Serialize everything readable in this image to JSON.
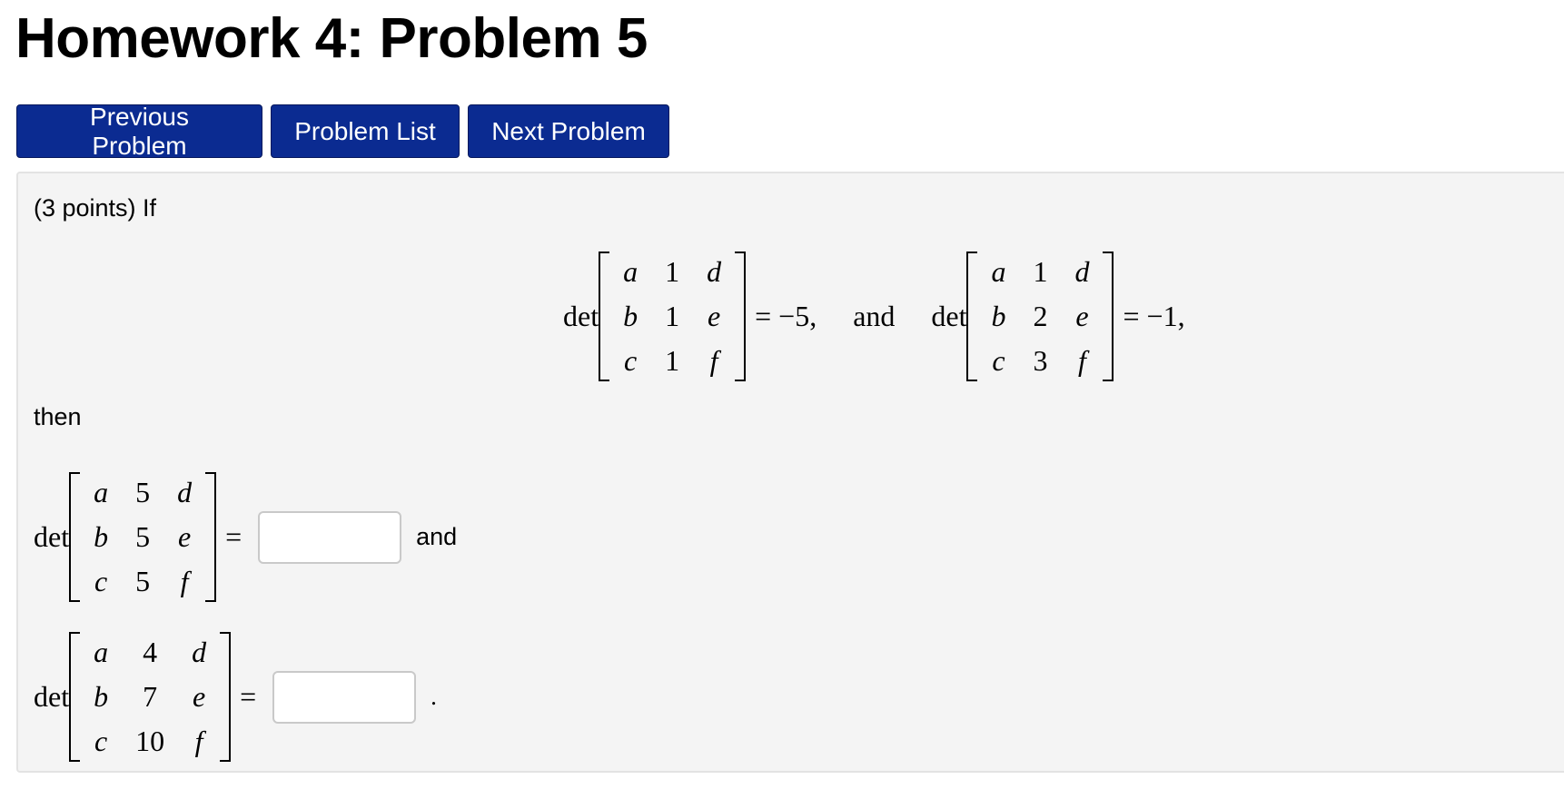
{
  "page": {
    "title": "Homework 4: Problem 5"
  },
  "nav": {
    "previous_label": "Previous Problem",
    "list_label": "Problem List",
    "next_label": "Next Problem"
  },
  "problem": {
    "intro": "(3 points) If",
    "then": "then",
    "and_word": "and",
    "period": ".",
    "det": "det",
    "equals": "=",
    "given": [
      {
        "matrix": [
          [
            "a",
            "1",
            "d"
          ],
          [
            "b",
            "1",
            "e"
          ],
          [
            "c",
            "1",
            "f"
          ]
        ],
        "result": "= −5,"
      },
      {
        "connector": "and",
        "matrix": [
          [
            "a",
            "1",
            "d"
          ],
          [
            "b",
            "2",
            "e"
          ],
          [
            "c",
            "3",
            "f"
          ]
        ],
        "result": "= −1,"
      }
    ],
    "questions": [
      {
        "matrix": [
          [
            "a",
            "5",
            "d"
          ],
          [
            "b",
            "5",
            "e"
          ],
          [
            "c",
            "5",
            "f"
          ]
        ],
        "answer_value": ""
      },
      {
        "matrix": [
          [
            "a",
            "4",
            "d"
          ],
          [
            "b",
            "7",
            "e"
          ],
          [
            "c",
            "10",
            "f"
          ]
        ],
        "answer_value": ""
      }
    ]
  }
}
